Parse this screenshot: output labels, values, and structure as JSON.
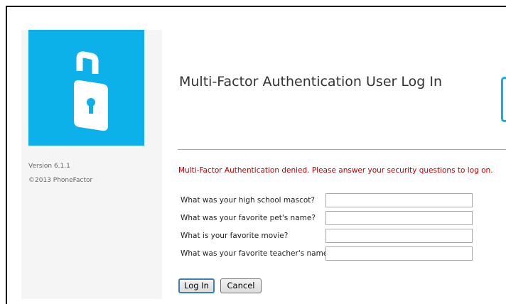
{
  "sidebar": {
    "logo_icon": "phone-padlock-icon",
    "brand_color": "#0db1ea",
    "version": "Version 6.1.1",
    "copyright": "©2013 PhoneFactor"
  },
  "main": {
    "title": "Multi-Factor Authentication User Log In",
    "error_message": "Multi-Factor Authentication denied. Please answer your security questions to log on.",
    "error_color": "#c00000",
    "questions": [
      {
        "label": "What was your high school mascot?",
        "value": ""
      },
      {
        "label": "What was your favorite pet's name?",
        "value": ""
      },
      {
        "label": "What is your favorite movie?",
        "value": ""
      },
      {
        "label": "What was your favorite teacher's name?",
        "value": ""
      }
    ],
    "login_label": "Log In",
    "cancel_label": "Cancel"
  }
}
